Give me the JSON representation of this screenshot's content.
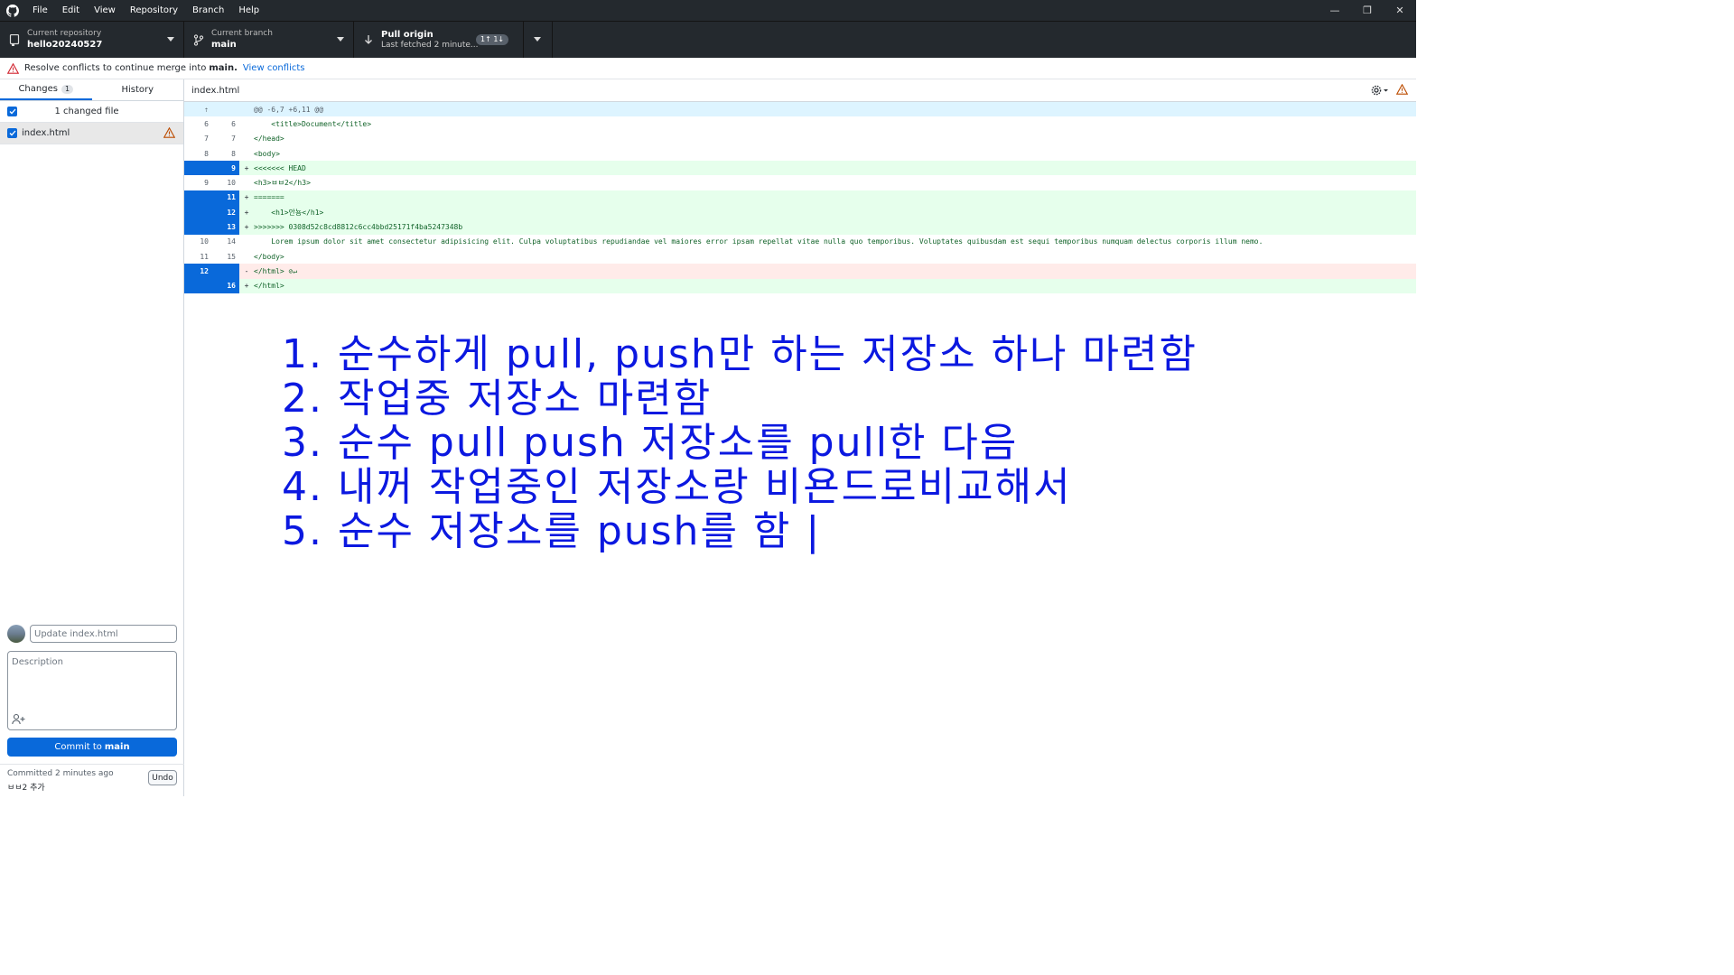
{
  "menu": [
    "File",
    "Edit",
    "View",
    "Repository",
    "Branch",
    "Help"
  ],
  "toolbar": {
    "repo_label": "Current repository",
    "repo_value": "hello20240527",
    "branch_label": "Current branch",
    "branch_value": "main",
    "pull_label": "Pull origin",
    "pull_sub": "Last fetched 2 minute...",
    "pull_badge": "1↑ 1↓"
  },
  "banner": {
    "text": "Resolve conflicts to continue merge into",
    "branch": "main.",
    "link": "View conflicts"
  },
  "sidebar": {
    "tabs": [
      {
        "label": "Changes",
        "count": "1"
      },
      {
        "label": "History"
      }
    ],
    "changed_header": "1 changed file",
    "file": "index.html",
    "summary_placeholder": "Update index.html",
    "description_placeholder": "Description",
    "commit_prefix": "Commit to",
    "commit_branch": "main",
    "last_commit_time": "Committed 2 minutes ago",
    "last_commit_msg": "ㅂㅂ2 추가",
    "undo": "Undo"
  },
  "diff": {
    "filename": "index.html",
    "hunk": "@@ -6,7 +6,11 @@",
    "rows": [
      {
        "old": "6",
        "new": "6",
        "mark": "",
        "type": "ctx",
        "code": "    <title>Document</title>"
      },
      {
        "old": "7",
        "new": "7",
        "mark": "",
        "type": "ctx",
        "code": "</head>"
      },
      {
        "old": "8",
        "new": "8",
        "mark": "",
        "type": "ctx",
        "code": "<body>"
      },
      {
        "old": "",
        "new": "9",
        "mark": "+",
        "type": "add",
        "code": "<<<<<<< HEAD"
      },
      {
        "old": "9",
        "new": "10",
        "mark": "",
        "type": "ctx",
        "code": "<h3>ㅂㅂ2</h3>"
      },
      {
        "old": "",
        "new": "11",
        "mark": "+",
        "type": "add",
        "code": "======="
      },
      {
        "old": "",
        "new": "12",
        "mark": "+",
        "type": "add",
        "code": "    <h1>안뇽</h1>"
      },
      {
        "old": "",
        "new": "13",
        "mark": "+",
        "type": "add",
        "code": ">>>>>>> 0308d52c8cd8812c6cc4bbd25171f4ba5247348b"
      },
      {
        "old": "10",
        "new": "14",
        "mark": "",
        "type": "ctx",
        "code": "    Lorem ipsum dolor sit amet consectetur adipisicing elit. Culpa voluptatibus repudiandae vel maiores error ipsam repellat vitae nulla quo temporibus. Voluptates quibusdam est sequi temporibus numquam delectus corporis illum nemo."
      },
      {
        "old": "11",
        "new": "15",
        "mark": "",
        "type": "ctx",
        "code": "</body>"
      },
      {
        "old": "12",
        "new": "",
        "mark": "-",
        "type": "del",
        "code": "</html> ⊘↵"
      },
      {
        "old": "",
        "new": "16",
        "mark": "+",
        "type": "add",
        "code": "</html>"
      }
    ]
  },
  "notes": [
    "1. 순수하게 pull, push만 하는 저장소 하나 마련함",
    "2. 작업중 저장소 마련함",
    "3. 순수 pull push 저장소를 pull한 다음",
    "4. 내꺼 작업중인 저장소랑 비욘드로비교해서",
    "5. 순수 저장소를 push를 함 |"
  ],
  "colors": {
    "accent": "#0969da",
    "handwriting": "#0b18e0",
    "titlebar": "#24292e"
  }
}
